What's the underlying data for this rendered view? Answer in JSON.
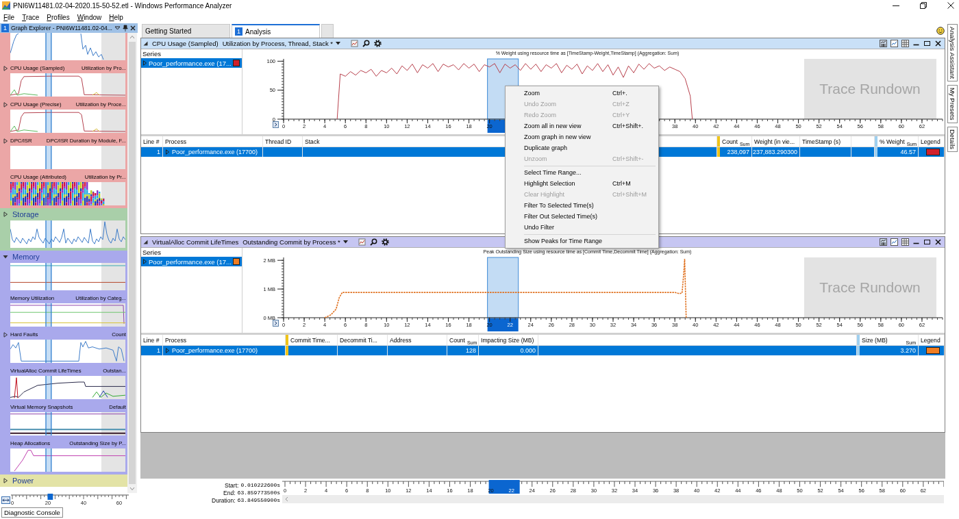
{
  "window": {
    "title": "PNI6W11481.02-04-2020.15-50-52.etl - Windows Performance Analyzer"
  },
  "menu_bar": [
    "File",
    "Trace",
    "Profiles",
    "Window",
    "Help"
  ],
  "graph_explorer": {
    "badge": "1",
    "title": "Graph Explorer - PNI6W11481.02-04...",
    "groups": [
      {
        "color": "#eba6a6",
        "graphs": [
          {
            "kind": "spiky"
          },
          {
            "title": "CPU Usage (Sampled)",
            "subtitle": "Utilization by Pro...",
            "kind": "plateau",
            "expandable": true
          },
          {
            "title": "CPU Usage (Precise)",
            "subtitle": "Utilization by Proce...",
            "kind": "plateau",
            "expandable": true
          },
          {
            "title": "DPC/ISR",
            "subtitle": "DPC/ISR Duration by Module, F...",
            "kind": "empty",
            "expandable": true
          },
          {
            "title": "CPU Usage (Attributed)",
            "subtitle": "Utilization by Pr...",
            "kind": "bars",
            "expandable": false
          }
        ]
      },
      {
        "name": "Storage",
        "expanded": false,
        "color": "#a9cfa9",
        "graphs": [
          {
            "kind": "noisy"
          }
        ]
      },
      {
        "name": "Memory",
        "expanded": true,
        "color": "#a9a9ec",
        "graphs": [
          {
            "kind": "flat-lines"
          },
          {
            "title": "Memory Utilization",
            "subtitle": "Utilization by Categ...",
            "kind": "three-lines",
            "expandable": false
          },
          {
            "title": "Hard Faults",
            "subtitle": "Count",
            "kind": "drop-line",
            "expandable": true
          },
          {
            "title": "VirtualAlloc Commit LifeTimes",
            "subtitle": "Outstan...",
            "kind": "multi",
            "expandable": false
          },
          {
            "title": "Virtual Memory Snapshots",
            "subtitle": "Default",
            "kind": "snapshot-lines",
            "expandable": false
          },
          {
            "title": "Heap Allocations",
            "subtitle": "Outstanding Size by P...",
            "kind": "hump",
            "expandable": false
          }
        ]
      },
      {
        "name": "Power",
        "expanded": false,
        "color": "#e3e3a6"
      }
    ],
    "axis_ticks": [
      "0",
      "20",
      "40",
      "60"
    ]
  },
  "diagnostic_console": "Diagnostic Console",
  "tabs": [
    {
      "label": "Getting Started",
      "selected": false
    },
    {
      "badge": "1",
      "label": "Analysis",
      "selected": true
    }
  ],
  "panels": [
    {
      "title": "CPU Usage (Sampled)",
      "subtitle": "Utilization by Process, Thread, Stack *",
      "color": "#c9e0f7",
      "series_header": "Series",
      "series": [
        {
          "name": "Poor_performance.exe (17...",
          "color": "#d0202c",
          "selected": true
        }
      ],
      "chart_data": {
        "type": "line",
        "title": "% Weight using resource time as [TimeStamp-Weight,TimeStamp] (Aggregation: Sum)",
        "x": [
          5.2,
          5.5,
          6,
          6.5,
          7,
          7.5,
          8,
          8.5,
          9,
          9.5,
          10,
          10.5,
          11,
          11.5,
          12,
          12.5,
          13,
          13.5,
          14,
          14.5,
          15,
          15.5,
          16,
          16.5,
          17,
          17.5,
          18,
          18.5,
          19,
          19.5,
          20,
          20.5,
          21,
          21.5,
          22,
          22.5,
          23,
          23.5,
          24,
          24.5,
          25,
          25.5,
          26,
          26.5,
          27,
          27.5,
          28,
          28.5,
          29,
          29.5,
          30,
          30.5,
          31,
          31.5,
          32,
          32.5,
          33,
          33.5,
          34,
          34.5,
          35,
          35.5,
          36,
          36.5,
          37,
          37.5,
          38,
          38.5,
          39,
          39.5,
          39.7
        ],
        "series": [
          {
            "color": "#b8404c",
            "values": [
              0,
              78,
              74,
              82,
              76,
              84,
              80,
              86,
              74,
              84,
              80,
              88,
              78,
              92,
              84,
              95,
              80,
              94,
              88,
              96,
              82,
              95,
              90,
              94,
              85,
              96,
              88,
              95,
              82,
              94,
              90,
              96,
              80,
              95,
              88,
              94,
              84,
              96,
              86,
              95,
              82,
              94,
              88,
              96,
              80,
              93,
              86,
              95,
              78,
              92,
              84,
              96,
              82,
              94,
              76,
              90,
              72,
              92,
              80,
              95,
              86,
              96,
              88,
              92,
              84,
              90,
              86,
              82,
              70,
              40,
              0
            ]
          }
        ],
        "xlim": [
          0,
          64
        ],
        "ylim": [
          0,
          104
        ],
        "xticks": [
          0,
          2,
          4,
          6,
          8,
          10,
          12,
          14,
          16,
          18,
          20,
          38,
          40,
          42,
          44,
          46,
          48,
          50,
          52,
          54,
          56,
          58,
          60,
          62
        ],
        "yticks": [
          0,
          50,
          100
        ]
      },
      "rundown": "Trace Rundown",
      "table": {
        "columns": [
          {
            "kind": "number",
            "label": "Line #"
          },
          {
            "kind": "tree",
            "label": "Process"
          },
          {
            "kind": "text",
            "label": "Thread ID"
          },
          {
            "kind": "text",
            "label": "Stack"
          },
          {
            "kind": "blank"
          },
          {
            "kind": "key-bar"
          },
          {
            "kind": "number",
            "label": "Count",
            "agg": "Sum"
          },
          {
            "kind": "number",
            "label": "Weight (in vie..."
          },
          {
            "kind": "text",
            "label": "TimeStamp (s)"
          },
          {
            "kind": "blank"
          },
          {
            "kind": "graph-bar"
          },
          {
            "kind": "number",
            "label": "% Weight",
            "agg": "Sum"
          },
          {
            "kind": "legend",
            "label": "Legend"
          }
        ],
        "rows": [
          {
            "selected": true,
            "cells": [
              "1",
              "Poor_performance.exe (17700)",
              null,
              null,
              null,
              null,
              "238,097",
              "237,883.290300",
              null,
              null,
              null,
              "46.57",
              null
            ],
            "color": "#d0202c"
          }
        ]
      }
    },
    {
      "title": "VirtualAlloc Commit LifeTimes",
      "subtitle": "Outstanding Commit by Process *",
      "color": "#c6c6f2",
      "series_header": "Series",
      "series": [
        {
          "name": "Poor_performance.exe (17...",
          "color": "#f07d22",
          "selected": true
        }
      ],
      "chart_data": {
        "type": "line",
        "title": "Peak Outstanding Size using resource time as [Commit Time,Decommit Time] (Aggregation: Sum)",
        "x": [
          4,
          4.6,
          5.1,
          5.4,
          5.7,
          6,
          38,
          38.4,
          38.7,
          38.85,
          38.95,
          39.1
        ],
        "series": [
          {
            "color": "#e0701e",
            "line_style": "dotted",
            "values": [
              0,
              0.1,
              0.3,
              0.7,
              0.88,
              0.88,
              0.88,
              0.84,
              0.86,
              1.5,
              2.05,
              0
            ]
          }
        ],
        "xlim": [
          0,
          64
        ],
        "ylim": [
          0,
          2.1
        ],
        "xticks": [
          0,
          2,
          4,
          6,
          8,
          10,
          12,
          14,
          16,
          18,
          20,
          22,
          24,
          26,
          28,
          30,
          32,
          34,
          36,
          38,
          40,
          42,
          44,
          46,
          48,
          50,
          52,
          54,
          56,
          58,
          60,
          62
        ],
        "yticks": [
          {
            "value": 0,
            "label": "0 MB"
          },
          {
            "value": 1,
            "label": "1 MB"
          },
          {
            "value": 2,
            "label": "2 MB"
          }
        ]
      },
      "rundown": "Trace Rundown",
      "table": {
        "columns": [
          {
            "kind": "number",
            "label": "Line #"
          },
          {
            "kind": "tree",
            "label": "Process"
          },
          {
            "kind": "key-bar"
          },
          {
            "kind": "text",
            "label": "Commit Time..."
          },
          {
            "kind": "text",
            "label": "Decommit Ti..."
          },
          {
            "kind": "text",
            "label": "Address"
          },
          {
            "kind": "number",
            "label": "Count",
            "agg": "Sum"
          },
          {
            "kind": "number",
            "label": "Impacting Size (MB)"
          },
          {
            "kind": "blank"
          },
          {
            "kind": "graph-bar"
          },
          {
            "kind": "number",
            "label": "Size (MB)",
            "agg": "Sum"
          },
          {
            "kind": "legend",
            "label": "Legend"
          }
        ],
        "rows": [
          {
            "selected": true,
            "cells": [
              "1",
              "Poor_performance.exe (17700)",
              null,
              null,
              null,
              null,
              "128",
              "0.000",
              null,
              null,
              "3.270",
              null
            ],
            "color": "#f07d22"
          }
        ]
      }
    }
  ],
  "context_menu": [
    {
      "kind": "item",
      "label": "Zoom",
      "shortcut": "Ctrl+.",
      "disabled": false
    },
    {
      "kind": "item",
      "label": "Undo Zoom",
      "shortcut": "Ctrl+Z",
      "disabled": true
    },
    {
      "kind": "item",
      "label": "Redo Zoom",
      "shortcut": "Ctrl+Y",
      "disabled": true
    },
    {
      "kind": "item",
      "label": "Zoom all in new view",
      "shortcut": "Ctrl+Shift+.",
      "disabled": false
    },
    {
      "kind": "item",
      "label": "Zoom graph in new view",
      "disabled": false
    },
    {
      "kind": "item",
      "label": "Duplicate graph",
      "disabled": false
    },
    {
      "kind": "item",
      "label": "Unzoom",
      "shortcut": "Ctrl+Shift+-",
      "disabled": true
    },
    {
      "kind": "separator"
    },
    {
      "kind": "item",
      "label": "Select Time Range...",
      "disabled": false
    },
    {
      "kind": "item",
      "label": "Highlight Selection",
      "shortcut": "Ctrl+M",
      "disabled": false
    },
    {
      "kind": "item",
      "label": "Clear Highlight",
      "shortcut": "Ctrl+Shift+M",
      "disabled": true
    },
    {
      "kind": "item",
      "label": "Filter To Selected Time(s)",
      "disabled": false
    },
    {
      "kind": "item",
      "label": "Filter Out Selected Time(s)",
      "disabled": false
    },
    {
      "kind": "item",
      "label": "Undo Filter",
      "disabled": false
    },
    {
      "kind": "separator"
    },
    {
      "kind": "item",
      "label": "Show Peaks for Time Range",
      "disabled": false
    }
  ],
  "timeline": {
    "rows": [
      {
        "label": "Start:",
        "value": "0.010222600s"
      },
      {
        "label": "End:",
        "value": "63.859773500s"
      },
      {
        "label": "Duration:",
        "value": "63.849550900s"
      }
    ],
    "ticks": [
      "0",
      "2",
      "4",
      "6",
      "8",
      "10",
      "12",
      "14",
      "16",
      "18",
      "20",
      "22",
      "24",
      "26",
      "28",
      "30",
      "32",
      "34",
      "36",
      "38",
      "40",
      "42",
      "44",
      "46",
      "48",
      "50",
      "52",
      "54",
      "56",
      "58",
      "60",
      "62"
    ]
  },
  "side_tabs": [
    "Analysis Assistant",
    "My Presets",
    "Details"
  ]
}
